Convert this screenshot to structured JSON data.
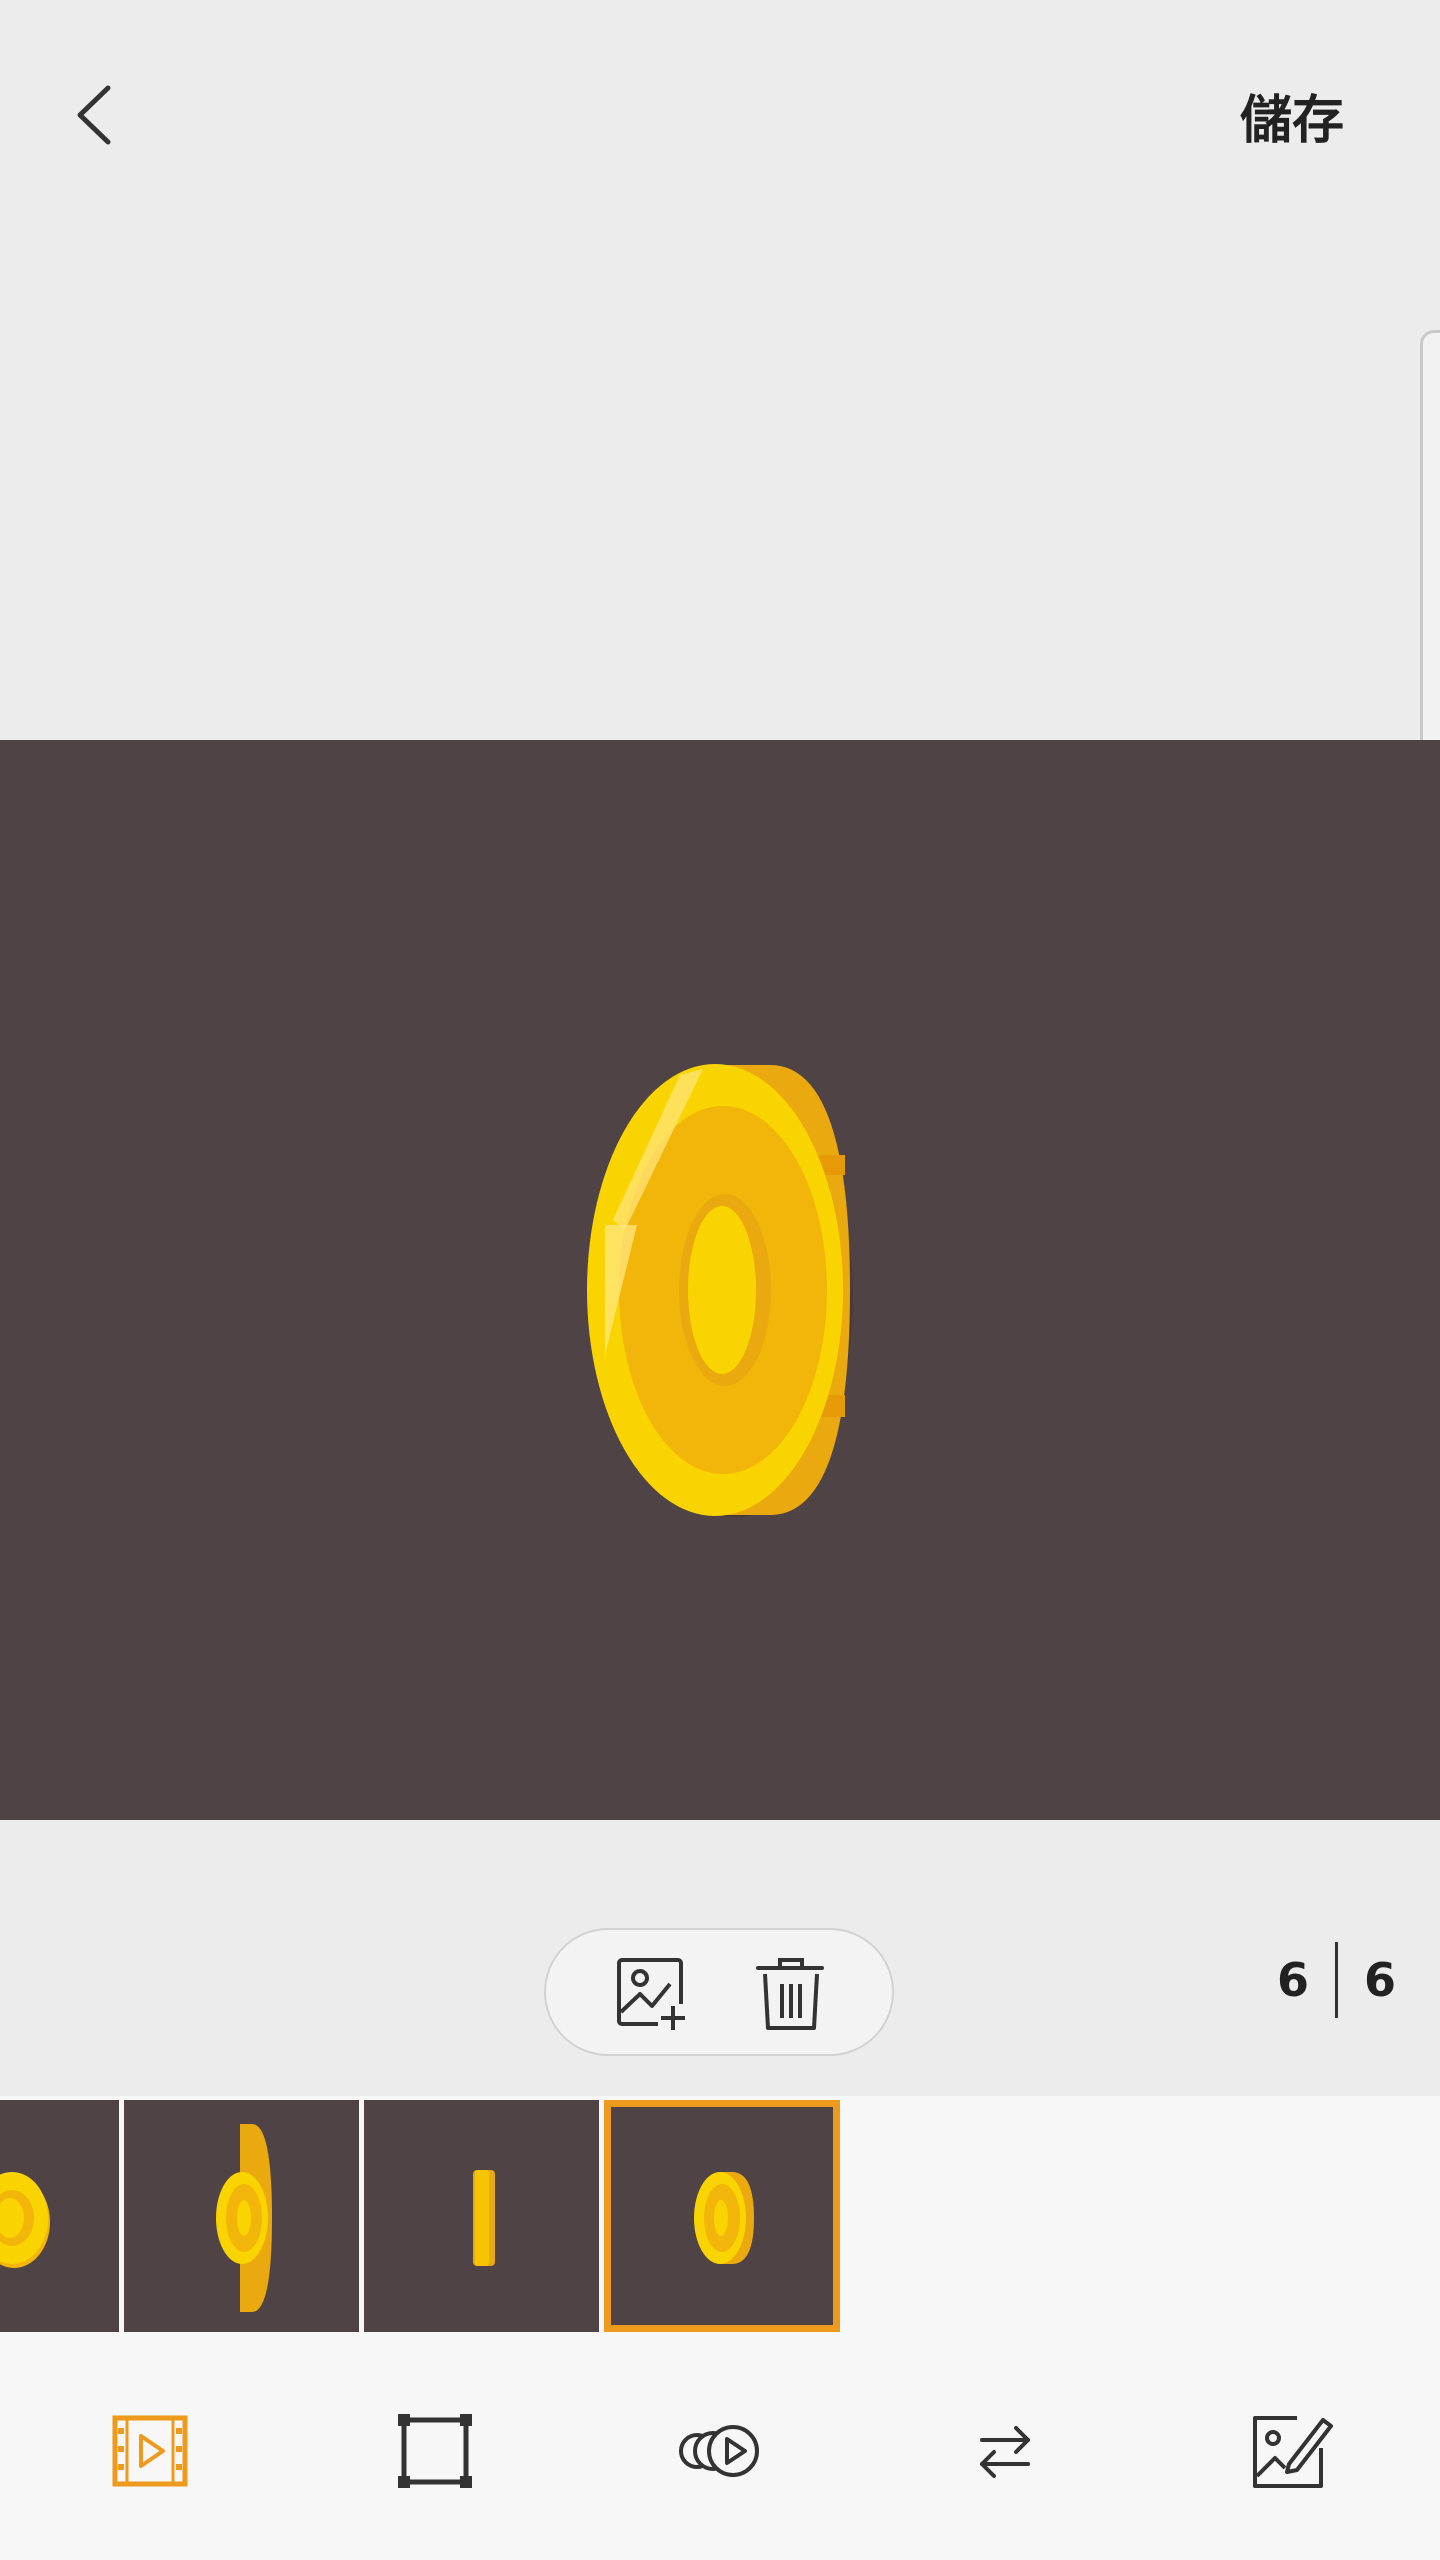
{
  "header": {
    "back_icon": "chevron-left-icon",
    "save_label": "儲存"
  },
  "preview": {
    "background": "#504345",
    "current_frame_icon": "gold-coin-icon"
  },
  "frame_actions": {
    "add_icon": "add-image-icon",
    "delete_icon": "trash-icon"
  },
  "counter": {
    "current": "6",
    "total": "6"
  },
  "filmstrip": {
    "frames": [
      {
        "label": "frame-3",
        "icon": "coin-front-icon"
      },
      {
        "label": "frame-4",
        "icon": "coin-tilted-icon"
      },
      {
        "label": "frame-5",
        "icon": "coin-edge-icon"
      },
      {
        "label": "frame-6",
        "icon": "coin-tilted-icon",
        "selected": true
      }
    ]
  },
  "toolbar": {
    "items": [
      {
        "icon": "frames-icon",
        "active": true
      },
      {
        "icon": "crop-icon"
      },
      {
        "icon": "speed-icon"
      },
      {
        "icon": "reverse-icon"
      },
      {
        "icon": "edit-icon"
      }
    ]
  },
  "colors": {
    "accent": "#ee9a1d",
    "coin_gold": "#f7c400",
    "icon_dark": "#333333"
  }
}
